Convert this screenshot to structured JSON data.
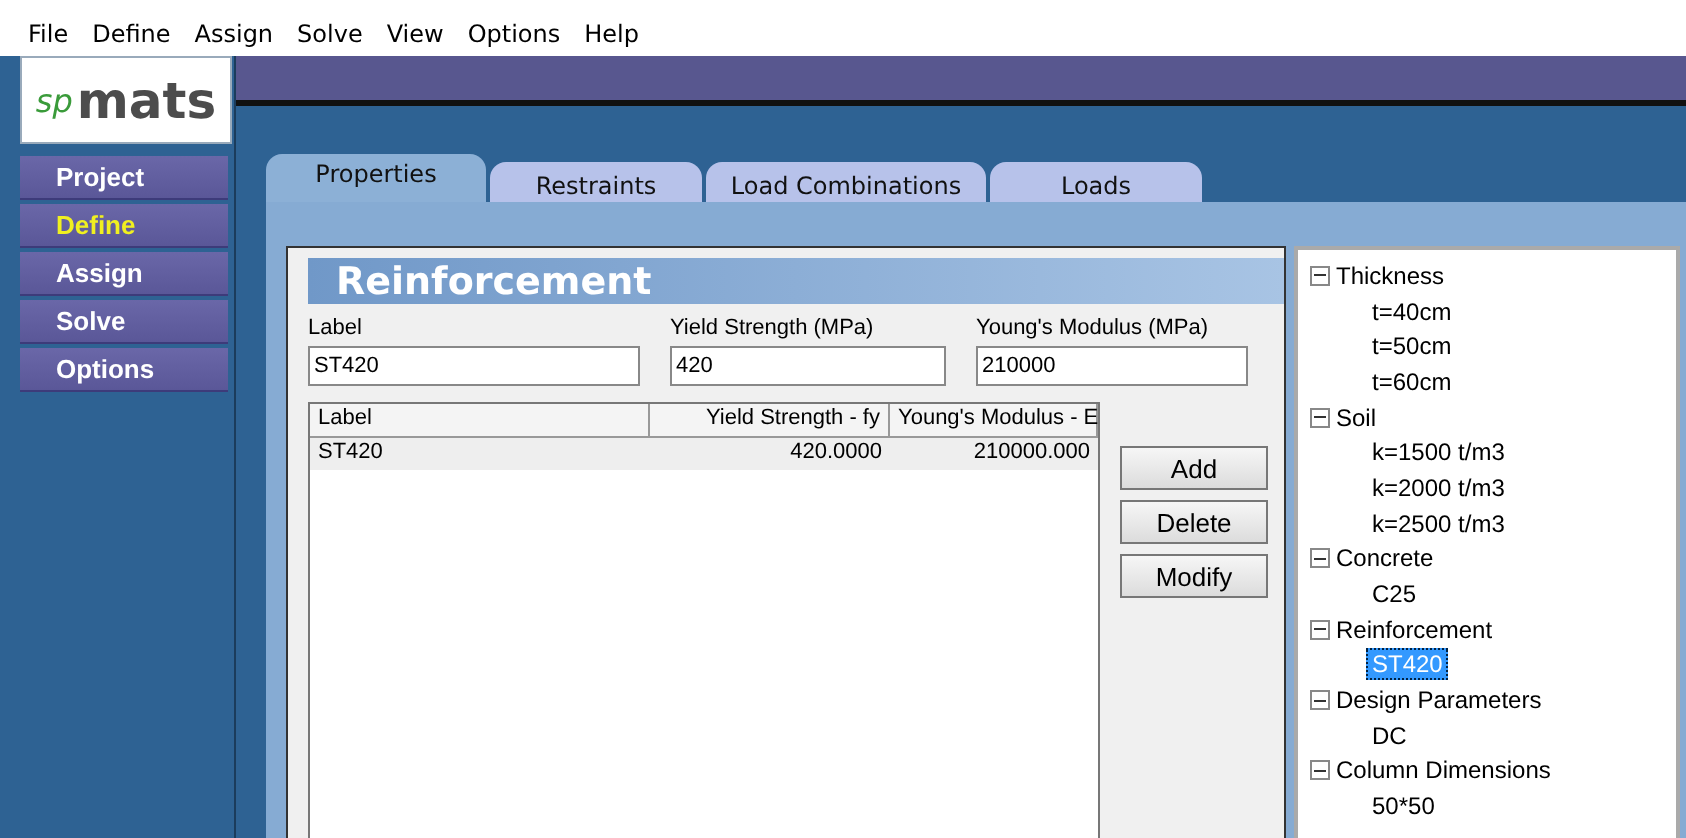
{
  "menu": [
    "File",
    "Define",
    "Assign",
    "Solve",
    "View",
    "Options",
    "Help"
  ],
  "logo": {
    "prefix": "sp",
    "name": "mats"
  },
  "sidebar": [
    {
      "label": "Project",
      "selected": false
    },
    {
      "label": "Define",
      "selected": true
    },
    {
      "label": "Assign",
      "selected": false
    },
    {
      "label": "Solve",
      "selected": false
    },
    {
      "label": "Options",
      "selected": false
    }
  ],
  "tabs": [
    {
      "label": "Properties",
      "selected": true
    },
    {
      "label": "Restraints",
      "selected": false
    },
    {
      "label": "Load Combinations",
      "selected": false
    },
    {
      "label": "Loads",
      "selected": false
    }
  ],
  "section_title": "Reinforcement",
  "fields": [
    {
      "label": "Label",
      "value": "ST420"
    },
    {
      "label": "Yield  Strength (MPa)",
      "value": "420"
    },
    {
      "label": "Young's Modulus (MPa)",
      "value": "210000"
    }
  ],
  "table": {
    "columns": [
      "Label",
      "Yield Strength - fy",
      "Young's Modulus - E"
    ],
    "rows": [
      [
        "ST420",
        "420.0000",
        "210000.000"
      ]
    ]
  },
  "buttons": [
    "Add",
    "Delete",
    "Modify"
  ],
  "tree": [
    {
      "label": "Thickness",
      "expanded": true,
      "children": [
        {
          "label": "t=40cm",
          "selected": false
        },
        {
          "label": "t=50cm",
          "selected": false
        },
        {
          "label": "t=60cm",
          "selected": false
        }
      ]
    },
    {
      "label": "Soil",
      "expanded": true,
      "children": [
        {
          "label": "k=1500 t/m3",
          "selected": false
        },
        {
          "label": "k=2000 t/m3",
          "selected": false
        },
        {
          "label": "k=2500 t/m3",
          "selected": false
        }
      ]
    },
    {
      "label": "Concrete",
      "expanded": true,
      "children": [
        {
          "label": "C25",
          "selected": false
        }
      ]
    },
    {
      "label": "Reinforcement",
      "expanded": true,
      "children": [
        {
          "label": "ST420",
          "selected": true
        }
      ]
    },
    {
      "label": "Design Parameters",
      "expanded": true,
      "children": [
        {
          "label": "DC",
          "selected": false
        }
      ]
    },
    {
      "label": "Column Dimensions",
      "expanded": true,
      "children": [
        {
          "label": "50*50",
          "selected": false
        }
      ]
    }
  ]
}
